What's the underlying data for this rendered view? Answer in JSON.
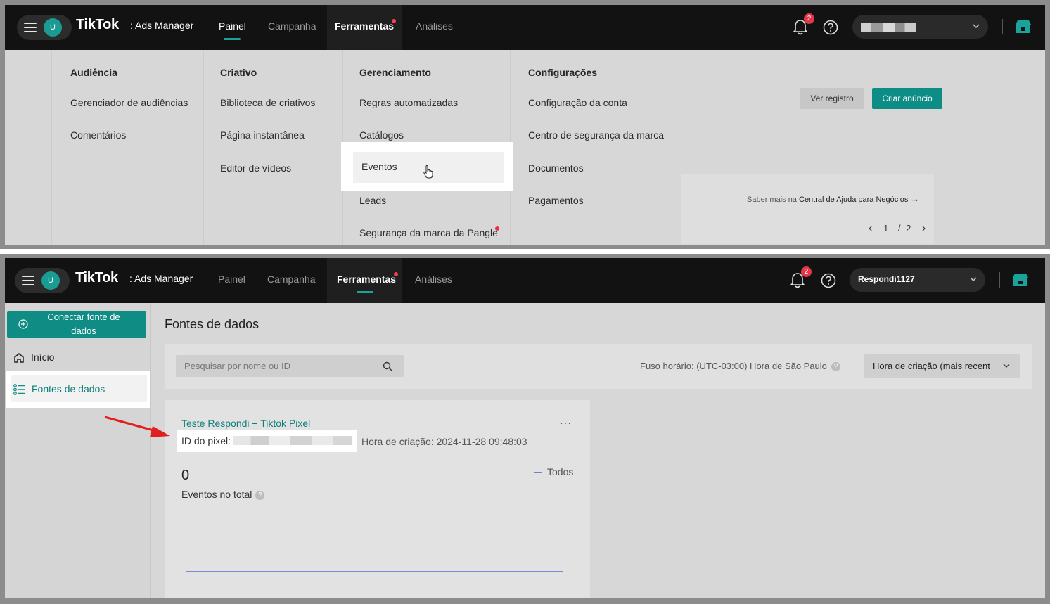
{
  "top": {
    "nav": {
      "avatar_initial": "U",
      "logo": "TikTok",
      "logo_sub": ": Ads Manager",
      "tabs": [
        {
          "label": "Painel",
          "active": true
        },
        {
          "label": "Campanha",
          "active": false
        },
        {
          "label": "Ferramentas",
          "active": false,
          "dot": true
        },
        {
          "label": "Análises",
          "active": false
        }
      ],
      "notification_count": "2"
    },
    "menu": {
      "columns": [
        {
          "heading": "Audiência",
          "items": [
            "Gerenciador de audiências",
            "Comentários"
          ]
        },
        {
          "heading": "Criativo",
          "items": [
            "Biblioteca de criativos",
            "Página instantânea",
            "Editor de vídeos"
          ]
        },
        {
          "heading": "Gerenciamento",
          "items": [
            "Regras automatizadas",
            "Catálogos",
            "Eventos",
            "Leads",
            "Segurança da marca da Pangle"
          ]
        },
        {
          "heading": "Configurações",
          "items": [
            "Configuração da conta",
            "Centro de segurança da marca",
            "Documentos",
            "Pagamentos"
          ]
        }
      ],
      "highlighted_item": "Eventos"
    },
    "actions": {
      "view_log": "Ver registro",
      "create_ad": "Criar anúncio"
    },
    "help": {
      "prefix": "Saber mais na",
      "link": "Central de Ajuda para Negócios",
      "arrow": "→"
    },
    "pager": {
      "prev": "‹",
      "current": "1",
      "sep": "/",
      "total": "2",
      "next": "›"
    }
  },
  "bottom": {
    "nav": {
      "avatar_initial": "U",
      "logo": "TikTok",
      "logo_sub": ": Ads Manager",
      "tabs": [
        {
          "label": "Painel",
          "active": false
        },
        {
          "label": "Campanha",
          "active": false
        },
        {
          "label": "Ferramentas",
          "active": true,
          "dot": true
        },
        {
          "label": "Análises",
          "active": false
        }
      ],
      "notification_count": "2",
      "account_name": "Respondi1127"
    },
    "sidebar": {
      "connect_button": "Conectar fonte de dados",
      "items": [
        {
          "label": "Início",
          "icon": "home-icon",
          "active": false
        },
        {
          "label": "Fontes de dados",
          "icon": "list-icon",
          "active": true
        }
      ]
    },
    "content": {
      "title": "Fontes de dados",
      "search_placeholder": "Pesquisar por nome ou ID",
      "timezone": "Fuso horário: (UTC-03:00) Hora de São Paulo",
      "sort_label": "Hora de criação (mais recent",
      "pixel": {
        "name": "Teste Respondi + Tiktok Pixel",
        "id_label": "ID do pixel:",
        "created": "Hora de criação: 2024-11-28 09:48:03",
        "total_events": "0",
        "total_events_label": "Eventos no total",
        "legend": "Todos",
        "more": "···"
      }
    }
  },
  "colors": {
    "accent": "#0f8c84",
    "nav_bg": "#121212",
    "alert": "#e5364a"
  }
}
